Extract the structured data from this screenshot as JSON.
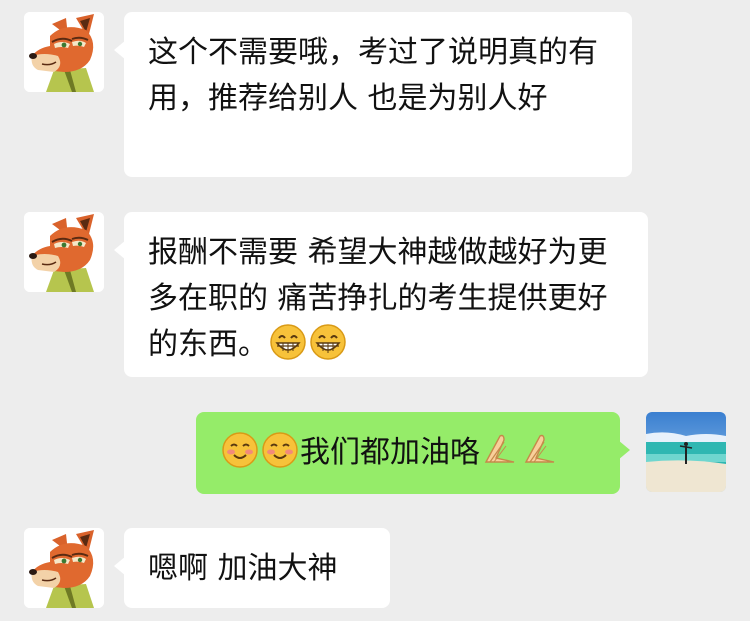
{
  "messages": [
    {
      "side": "left",
      "text": "这个不需要哦，考过了说明真的有用，推荐给别人 也是为别人好",
      "avatar": "fox-avatar-icon"
    },
    {
      "side": "left",
      "text": "报酬不需要 希望大神越做越好为更多在职的 痛苦挣扎的考生提供更好的东西。",
      "emoji_suffix": [
        "grin-emoji",
        "grin-emoji"
      ],
      "avatar": "fox-avatar-icon"
    },
    {
      "side": "right",
      "text": "我们都加油咯",
      "emoji_prefix": [
        "smile-emoji",
        "smile-emoji"
      ],
      "emoji_suffix": [
        "pray-hands-emoji",
        "pray-hands-emoji"
      ],
      "avatar": "beach-photo-avatar"
    },
    {
      "side": "left",
      "text": "嗯啊 加油大神",
      "avatar": "fox-avatar-icon"
    }
  ],
  "colors": {
    "background": "#ededed",
    "incoming": "#ffffff",
    "outgoing": "#95ec69"
  }
}
